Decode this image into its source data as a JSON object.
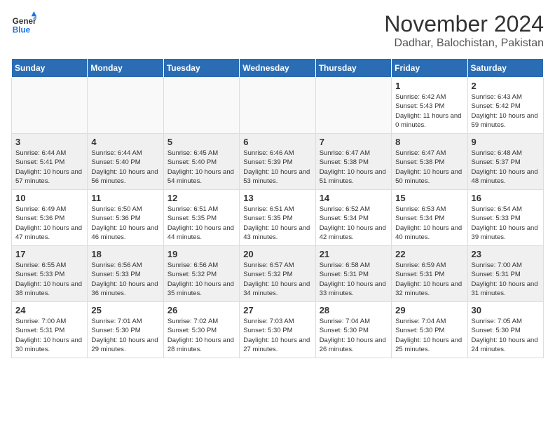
{
  "header": {
    "logo_line1": "General",
    "logo_line2": "Blue",
    "month": "November 2024",
    "location": "Dadhar, Balochistan, Pakistan"
  },
  "weekdays": [
    "Sunday",
    "Monday",
    "Tuesday",
    "Wednesday",
    "Thursday",
    "Friday",
    "Saturday"
  ],
  "weeks": [
    [
      {
        "day": "",
        "empty": true
      },
      {
        "day": "",
        "empty": true
      },
      {
        "day": "",
        "empty": true
      },
      {
        "day": "",
        "empty": true
      },
      {
        "day": "",
        "empty": true
      },
      {
        "day": "1",
        "sunrise": "6:42 AM",
        "sunset": "5:43 PM",
        "daylight": "11 hours and 0 minutes."
      },
      {
        "day": "2",
        "sunrise": "6:43 AM",
        "sunset": "5:42 PM",
        "daylight": "10 hours and 59 minutes."
      }
    ],
    [
      {
        "day": "3",
        "sunrise": "6:44 AM",
        "sunset": "5:41 PM",
        "daylight": "10 hours and 57 minutes."
      },
      {
        "day": "4",
        "sunrise": "6:44 AM",
        "sunset": "5:40 PM",
        "daylight": "10 hours and 56 minutes."
      },
      {
        "day": "5",
        "sunrise": "6:45 AM",
        "sunset": "5:40 PM",
        "daylight": "10 hours and 54 minutes."
      },
      {
        "day": "6",
        "sunrise": "6:46 AM",
        "sunset": "5:39 PM",
        "daylight": "10 hours and 53 minutes."
      },
      {
        "day": "7",
        "sunrise": "6:47 AM",
        "sunset": "5:38 PM",
        "daylight": "10 hours and 51 minutes."
      },
      {
        "day": "8",
        "sunrise": "6:47 AM",
        "sunset": "5:38 PM",
        "daylight": "10 hours and 50 minutes."
      },
      {
        "day": "9",
        "sunrise": "6:48 AM",
        "sunset": "5:37 PM",
        "daylight": "10 hours and 48 minutes."
      }
    ],
    [
      {
        "day": "10",
        "sunrise": "6:49 AM",
        "sunset": "5:36 PM",
        "daylight": "10 hours and 47 minutes."
      },
      {
        "day": "11",
        "sunrise": "6:50 AM",
        "sunset": "5:36 PM",
        "daylight": "10 hours and 46 minutes."
      },
      {
        "day": "12",
        "sunrise": "6:51 AM",
        "sunset": "5:35 PM",
        "daylight": "10 hours and 44 minutes."
      },
      {
        "day": "13",
        "sunrise": "6:51 AM",
        "sunset": "5:35 PM",
        "daylight": "10 hours and 43 minutes."
      },
      {
        "day": "14",
        "sunrise": "6:52 AM",
        "sunset": "5:34 PM",
        "daylight": "10 hours and 42 minutes."
      },
      {
        "day": "15",
        "sunrise": "6:53 AM",
        "sunset": "5:34 PM",
        "daylight": "10 hours and 40 minutes."
      },
      {
        "day": "16",
        "sunrise": "6:54 AM",
        "sunset": "5:33 PM",
        "daylight": "10 hours and 39 minutes."
      }
    ],
    [
      {
        "day": "17",
        "sunrise": "6:55 AM",
        "sunset": "5:33 PM",
        "daylight": "10 hours and 38 minutes."
      },
      {
        "day": "18",
        "sunrise": "6:56 AM",
        "sunset": "5:33 PM",
        "daylight": "10 hours and 36 minutes."
      },
      {
        "day": "19",
        "sunrise": "6:56 AM",
        "sunset": "5:32 PM",
        "daylight": "10 hours and 35 minutes."
      },
      {
        "day": "20",
        "sunrise": "6:57 AM",
        "sunset": "5:32 PM",
        "daylight": "10 hours and 34 minutes."
      },
      {
        "day": "21",
        "sunrise": "6:58 AM",
        "sunset": "5:31 PM",
        "daylight": "10 hours and 33 minutes."
      },
      {
        "day": "22",
        "sunrise": "6:59 AM",
        "sunset": "5:31 PM",
        "daylight": "10 hours and 32 minutes."
      },
      {
        "day": "23",
        "sunrise": "7:00 AM",
        "sunset": "5:31 PM",
        "daylight": "10 hours and 31 minutes."
      }
    ],
    [
      {
        "day": "24",
        "sunrise": "7:00 AM",
        "sunset": "5:31 PM",
        "daylight": "10 hours and 30 minutes."
      },
      {
        "day": "25",
        "sunrise": "7:01 AM",
        "sunset": "5:30 PM",
        "daylight": "10 hours and 29 minutes."
      },
      {
        "day": "26",
        "sunrise": "7:02 AM",
        "sunset": "5:30 PM",
        "daylight": "10 hours and 28 minutes."
      },
      {
        "day": "27",
        "sunrise": "7:03 AM",
        "sunset": "5:30 PM",
        "daylight": "10 hours and 27 minutes."
      },
      {
        "day": "28",
        "sunrise": "7:04 AM",
        "sunset": "5:30 PM",
        "daylight": "10 hours and 26 minutes."
      },
      {
        "day": "29",
        "sunrise": "7:04 AM",
        "sunset": "5:30 PM",
        "daylight": "10 hours and 25 minutes."
      },
      {
        "day": "30",
        "sunrise": "7:05 AM",
        "sunset": "5:30 PM",
        "daylight": "10 hours and 24 minutes."
      }
    ]
  ]
}
